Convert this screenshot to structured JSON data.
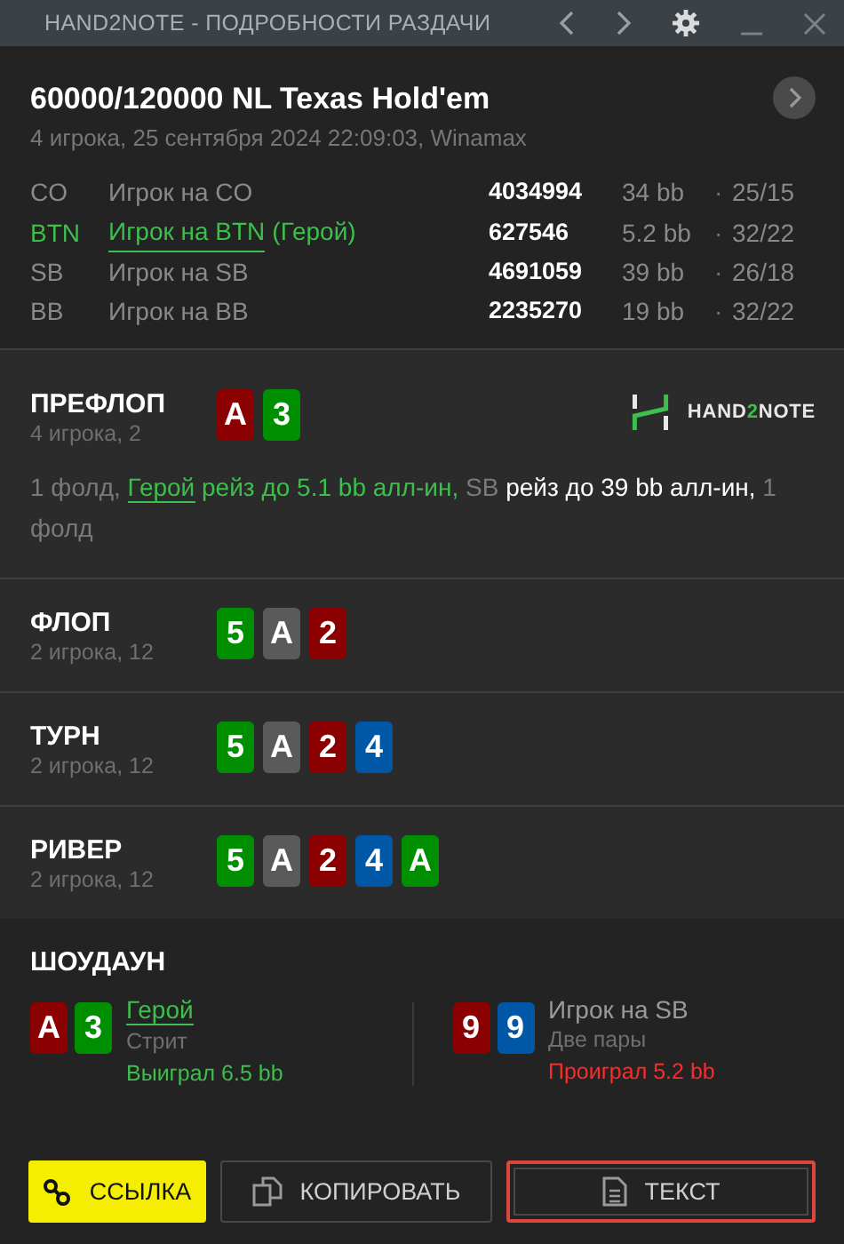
{
  "window": {
    "title": "HAND2NOTE - ПОДРОБНОСТИ РАЗДАЧИ"
  },
  "hand": {
    "title": "60000/120000 NL Texas Hold'em",
    "subtitle": "4 игрока, 25 сентября 2024 22:09:03, Winamax"
  },
  "players": [
    {
      "position": "CO",
      "name": "Игрок на CO",
      "hero": false,
      "id": "4034994",
      "stack": "34 bb",
      "separator": "·",
      "stats": "25/15"
    },
    {
      "position": "BTN",
      "name": "Игрок на BTN",
      "hero": true,
      "hero_suffix": "(Герой)",
      "id": "627546",
      "stack": "5.2 bb",
      "separator": "·",
      "stats": "32/22"
    },
    {
      "position": "SB",
      "name": "Игрок на SB",
      "hero": false,
      "id": "4691059",
      "stack": "39 bb",
      "separator": "·",
      "stats": "26/18"
    },
    {
      "position": "BB",
      "name": "Игрок на BB",
      "hero": false,
      "id": "2235270",
      "stack": "19 bb",
      "separator": "·",
      "stats": "32/22"
    }
  ],
  "logo": [
    {
      "text": "HAND",
      "accent": false
    },
    {
      "text": "2",
      "accent": true
    },
    {
      "text": "NOTE",
      "accent": false
    }
  ],
  "streets": [
    {
      "name": "ПРЕФЛОП",
      "info": "4 игрока, 2",
      "cards": [
        {
          "rank": "A",
          "color": "#8b0000"
        },
        {
          "rank": "3",
          "color": "#008f00"
        }
      ],
      "actions": [
        {
          "kind": "neutral",
          "text": "1 фолд, "
        },
        {
          "kind": "hero_link",
          "text": "Герой"
        },
        {
          "kind": "hero",
          "text": " рейз до 5.1 bb алл-ин, "
        },
        {
          "kind": "neutral",
          "text": "SB "
        },
        {
          "kind": "opponent",
          "text": "рейз до 39 bb алл-ин, "
        },
        {
          "kind": "neutral",
          "text": "1 фолд"
        }
      ]
    },
    {
      "name": "ФЛОП",
      "info": "2 игрока, 12",
      "cards": [
        {
          "rank": "5",
          "color": "#008f00"
        },
        {
          "rank": "A",
          "color": "#5a5a5a"
        },
        {
          "rank": "2",
          "color": "#8b0000"
        }
      ]
    },
    {
      "name": "ТУРН",
      "info": "2 игрока, 12",
      "cards": [
        {
          "rank": "5",
          "color": "#008f00"
        },
        {
          "rank": "A",
          "color": "#5a5a5a"
        },
        {
          "rank": "2",
          "color": "#8b0000"
        },
        {
          "rank": "4",
          "color": "#0057a8"
        }
      ]
    },
    {
      "name": "РИВЕР",
      "info": "2 игрока, 12",
      "cards": [
        {
          "rank": "5",
          "color": "#008f00"
        },
        {
          "rank": "A",
          "color": "#5a5a5a"
        },
        {
          "rank": "2",
          "color": "#8b0000"
        },
        {
          "rank": "4",
          "color": "#0057a8"
        },
        {
          "rank": "A",
          "color": "#008f00"
        }
      ]
    }
  ],
  "showdown": {
    "title": "ШОУДАУН",
    "players": [
      {
        "cards": [
          {
            "rank": "A",
            "color": "#8b0000"
          },
          {
            "rank": "3",
            "color": "#008f00"
          }
        ],
        "name": "Герой",
        "hero": true,
        "hand": "Стрит",
        "result": {
          "text": "Выиграл 6.5 bb",
          "color": "#3cbf4c"
        }
      },
      {
        "cards": [
          {
            "rank": "9",
            "color": "#8b0000"
          },
          {
            "rank": "9",
            "color": "#0057a8"
          }
        ],
        "name": "Игрок на SB",
        "hero": false,
        "hand": "Две пары",
        "result": {
          "text": "Проиграл 5.2 bb",
          "color": "#ff2a2a"
        }
      }
    ]
  },
  "buttons": [
    {
      "kind": "link",
      "label": "ССЫЛКА",
      "selected": false
    },
    {
      "kind": "copy",
      "label": "КОПИРОВАТЬ",
      "selected": false
    },
    {
      "kind": "text",
      "label": "ТЕКСТ",
      "selected": true
    }
  ]
}
